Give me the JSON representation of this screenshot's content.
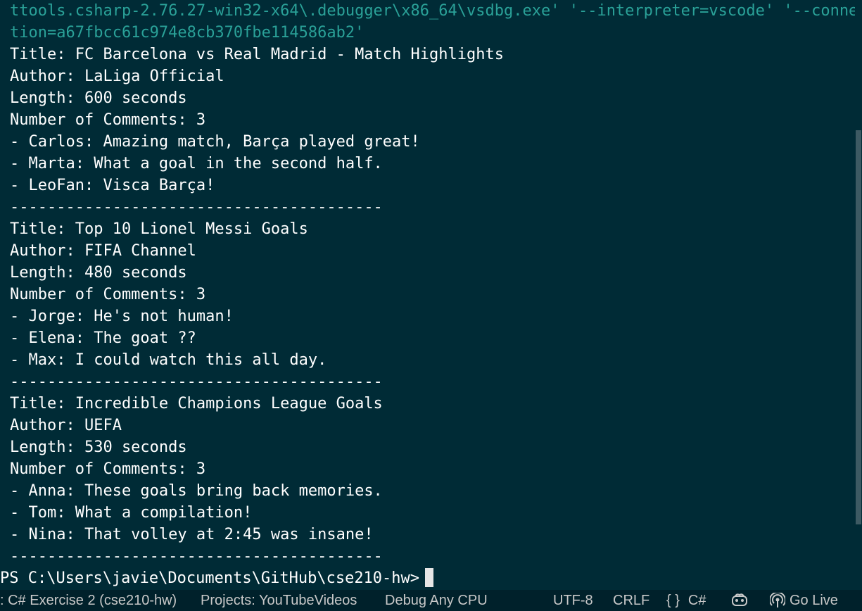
{
  "terminal": {
    "lines": [
      "ttools.csharp-2.76.27-win32-x64\\.debugger\\x86_64\\vsdbg.exe' '--interpreter=vscode' '--connec",
      "tion=a67fbcc61c974e8cb370fbe114586ab2'",
      "Title: FC Barcelona vs Real Madrid - Match Highlights",
      "Author: LaLiga Official",
      "Length: 600 seconds",
      "Number of Comments: 3",
      "- Carlos: Amazing match, Barça played great!",
      "- Marta: What a goal in the second half.",
      "- LeoFan: Visca Barça!",
      "----------------------------------------",
      "Title: Top 10 Lionel Messi Goals",
      "Author: FIFA Channel",
      "Length: 480 seconds",
      "Number of Comments: 3",
      "- Jorge: He's not human!",
      "- Elena: The goat ??",
      "- Max: I could watch this all day.",
      "----------------------------------------",
      "Title: Incredible Champions League Goals",
      "Author: UEFA",
      "Length: 530 seconds",
      "Number of Comments: 3",
      "- Anna: These goals bring back memories.",
      "- Tom: What a compilation!",
      "- Nina: That volley at 2:45 was insane!",
      "----------------------------------------"
    ],
    "prompt": "PS C:\\Users\\javie\\Documents\\GitHub\\cse210-hw>"
  },
  "statusbar": {
    "project_context": ": C# Exercise 2 (cse210-hw)",
    "projects": "Projects: YouTubeVideos",
    "debug_config": "Debug Any CPU",
    "encoding": "UTF-8",
    "line_ending": "CRLF",
    "language_glyph": "{ }",
    "language": "C#",
    "copilot_icon": "copilot-icon",
    "go_live_icon": "broadcast-icon",
    "go_live": "Go Live"
  },
  "colors": {
    "background": "#002b36",
    "statusbar_bg": "#00212b",
    "accent_text": "#2aa198",
    "text": "#ffffff"
  }
}
